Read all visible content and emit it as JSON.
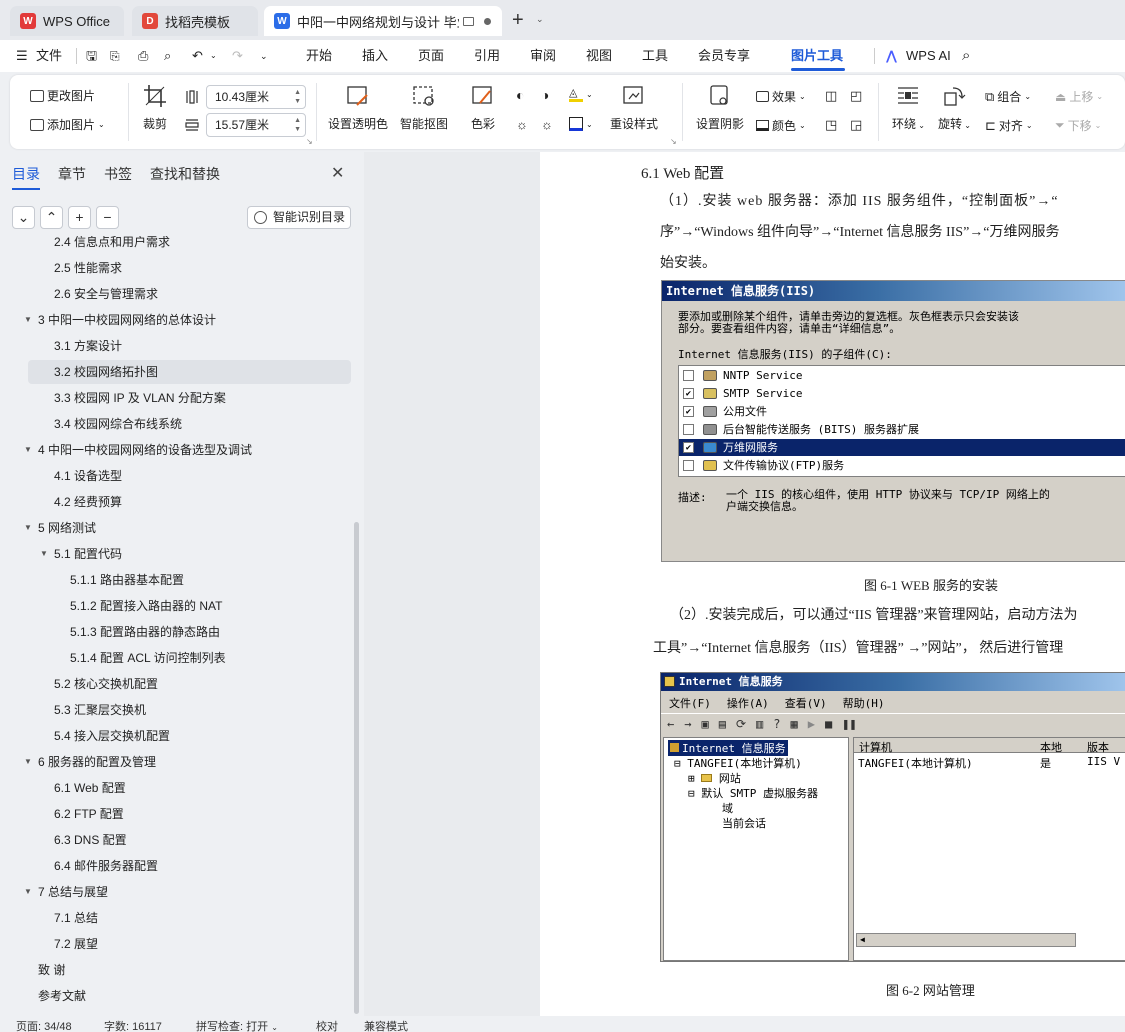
{
  "tabs": [
    {
      "label": "WPS Office"
    },
    {
      "label": "找稻壳模板"
    },
    {
      "label": "中阳一中网络规划与设计 毕业"
    }
  ],
  "new_tab_label": "+",
  "menu": {
    "file": "文件",
    "items": [
      "开始",
      "插入",
      "页面",
      "引用",
      "审阅",
      "视图",
      "工具",
      "会员专享",
      "图片工具"
    ],
    "active": "图片工具",
    "ai": "WPS AI"
  },
  "ribbon": {
    "change_pic": "更改图片",
    "add_pic": "添加图片",
    "crop": "裁剪",
    "width": "10.43厘米",
    "height": "15.57厘米",
    "transparent": "设置透明色",
    "smart_cutout": "智能抠图",
    "color_mode": "色彩",
    "reset_style": "重设样式",
    "shadow": "设置阴影",
    "effects": "效果",
    "color": "颜色",
    "wrap": "环绕",
    "rotate": "旋转",
    "group": "组合",
    "align": "对齐",
    "move_up": "上移",
    "move_down": "下移",
    "accent": "#1e5bd8"
  },
  "nav": {
    "tabs": [
      "目录",
      "章节",
      "书签",
      "查找和替换"
    ],
    "active": "目录",
    "smart_btn": "智能识别目录",
    "items": [
      {
        "text": "2.4  信息点和用户需求",
        "level": 2
      },
      {
        "text": "2.5  性能需求",
        "level": 2
      },
      {
        "text": "2.6  安全与管理需求",
        "level": 2
      },
      {
        "text": "3  中阳一中校园网网络的总体设计",
        "level": 1,
        "expanded": true
      },
      {
        "text": "3.1  方案设计",
        "level": 2
      },
      {
        "text": "3.2  校园网络拓扑图",
        "level": 2,
        "selected": true
      },
      {
        "text": "3.3  校园网 IP 及 VLAN 分配方案",
        "level": 2
      },
      {
        "text": "3.4  校园网综合布线系统",
        "level": 2
      },
      {
        "text": "4  中阳一中校园网网络的设备选型及调试",
        "level": 1,
        "expanded": true
      },
      {
        "text": "4.1  设备选型",
        "level": 2
      },
      {
        "text": "4.2  经费预算",
        "level": 2
      },
      {
        "text": "5  网络测试",
        "level": 1,
        "expanded": true
      },
      {
        "text": "5.1  配置代码",
        "level": 2,
        "expanded": true
      },
      {
        "text": "5.1.1  路由器基本配置",
        "level": 3
      },
      {
        "text": "5.1.2  配置接入路由器的 NAT",
        "level": 3
      },
      {
        "text": "5.1.3  配置路由器的静态路由",
        "level": 3
      },
      {
        "text": "5.1.4  配置 ACL 访问控制列表",
        "level": 3
      },
      {
        "text": "5.2  核心交换机配置",
        "level": 2
      },
      {
        "text": "5.3  汇聚层交换机",
        "level": 2
      },
      {
        "text": "5.4  接入层交换机配置",
        "level": 2
      },
      {
        "text": "6  服务器的配置及管理",
        "level": 1,
        "expanded": true
      },
      {
        "text": "6.1 Web 配置",
        "level": 2
      },
      {
        "text": "6.2 FTP 配置",
        "level": 2
      },
      {
        "text": "6.3 DNS 配置",
        "level": 2
      },
      {
        "text": "6.4 邮件服务器配置",
        "level": 2
      },
      {
        "text": "7 总结与展望",
        "level": 1,
        "expanded": true
      },
      {
        "text": "7.1  总结",
        "level": 2
      },
      {
        "text": "7.2  展望",
        "level": 2
      },
      {
        "text": "致   谢",
        "level": 0
      },
      {
        "text": "参考文献",
        "level": 0
      }
    ]
  },
  "doc": {
    "heading": "6.1 Web 配置",
    "para1": [
      "（1）.安装 web 服务器：添加 IIS 服务组件，“控制面板”→“",
      "序”→“Windows  组件向导”→“Internet 信息服务 IIS”→“万维网服务",
      "始安装。"
    ],
    "fig1": {
      "title": "Internet 信息服务(IIS)",
      "desc1": "要添加或删除某个组件，请单击旁边的复选框。灰色框表示只会安装该",
      "desc2": "部分。要查看组件内容，请单击“详细信息”。",
      "sub": "Internet 信息服务(IIS) 的子组件(C):",
      "items": [
        {
          "name": "NNTP Service",
          "checked": false,
          "size": "1"
        },
        {
          "name": "SMTP Service",
          "checked": true,
          "size": "1"
        },
        {
          "name": "公用文件",
          "checked": true,
          "size": "1"
        },
        {
          "name": "后台智能传送服务 (BITS) 服务器扩展",
          "checked": false,
          "size": "0"
        },
        {
          "name": "万维网服务",
          "checked": true,
          "size": "8",
          "selected": true
        },
        {
          "name": "文件传输协议(FTP)服务",
          "checked": false,
          "size": "0"
        }
      ],
      "desc_label": "描述:",
      "desc_text1": "一个 IIS 的核心组件，使用 HTTP 协议来与 TCP/IP 网络上的",
      "desc_text2": "户端交换信息。",
      "caption": "图 6-1 WEB 服务的安装"
    },
    "para2": [
      "（2）.安装完成后，可以通过“IIS 管理器”来管理网站，启动方法为",
      "工具”→“Internet  信息服务（IIS）管理器” →”网站”，  然后进行管理"
    ],
    "fig2": {
      "title": "Internet 信息服务",
      "menus": [
        "文件(F)",
        "操作(A)",
        "查看(V)",
        "帮助(H)"
      ],
      "tree": [
        "Internet 信息服务",
        "TANGFEI(本地计算机)",
        "网站",
        "默认 SMTP 虚拟服务器",
        "域",
        "当前会话"
      ],
      "cols": [
        "计算机",
        "本地",
        "版本"
      ],
      "row": [
        "TANGFEI(本地计算机)",
        "是",
        "IIS V"
      ],
      "caption": "图 6-2  网站管理"
    }
  },
  "status": {
    "page": "页面: 34/48",
    "words": "字数: 16117",
    "spell": "拼写检查: 打开",
    "proof": "校对",
    "compat": "兼容模式"
  }
}
